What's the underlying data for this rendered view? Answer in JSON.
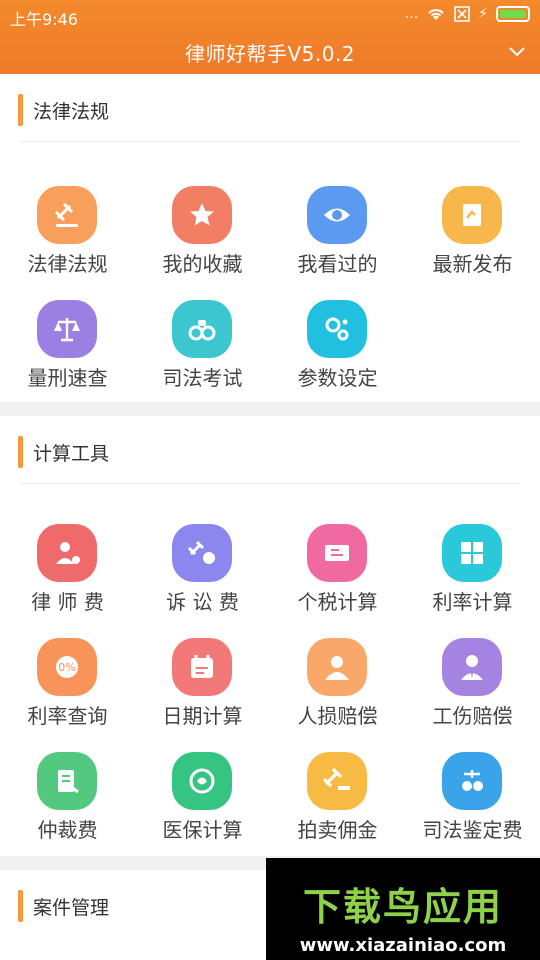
{
  "status_bar": {
    "time": "上午9:46",
    "dots": "...",
    "wifi": "wifi-icon",
    "sim": "sim-icon",
    "charge": "⚡"
  },
  "header": {
    "title": "律师好帮手V5.0.2"
  },
  "sections": {
    "laws": {
      "title": "法律法规",
      "items": [
        {
          "label": "法律法规",
          "icon": "gavel-icon",
          "color": "#f8a05b"
        },
        {
          "label": "我的收藏",
          "icon": "star-icon",
          "color": "#f27e63"
        },
        {
          "label": "我看过的",
          "icon": "eye-icon",
          "color": "#5b9af0"
        },
        {
          "label": "最新发布",
          "icon": "document-icon",
          "color": "#f7b74a"
        },
        {
          "label": "量刑速查",
          "icon": "scale-icon",
          "color": "#9b7fe3"
        },
        {
          "label": "司法考试",
          "icon": "handcuffs-icon",
          "color": "#3cc6cf"
        },
        {
          "label": "参数设定",
          "icon": "gears-icon",
          "color": "#21bfe0"
        }
      ]
    },
    "calc": {
      "title": "计算工具",
      "items": [
        {
          "label": "律 师 费",
          "icon": "lawyer-fee-icon",
          "color": "#ef6a6a"
        },
        {
          "label": "诉 讼 费",
          "icon": "litigation-fee-icon",
          "color": "#8c86ef"
        },
        {
          "label": "个税计算",
          "icon": "tax-icon",
          "color": "#f06aa0"
        },
        {
          "label": "利率计算",
          "icon": "calculator-icon",
          "color": "#29c9d9"
        },
        {
          "label": "利率查询",
          "icon": "percent-icon",
          "color": "#f8945a"
        },
        {
          "label": "日期计算",
          "icon": "calendar-icon",
          "color": "#f37878"
        },
        {
          "label": "人损赔偿",
          "icon": "person-icon",
          "color": "#f9a86a"
        },
        {
          "label": "工伤赔偿",
          "icon": "worker-icon",
          "color": "#a583e2"
        },
        {
          "label": "仲裁费",
          "icon": "form-icon",
          "color": "#52c97e"
        },
        {
          "label": "医保计算",
          "icon": "insurance-icon",
          "color": "#35c482"
        },
        {
          "label": "拍卖佣金",
          "icon": "auction-icon",
          "color": "#f7bb45"
        },
        {
          "label": "司法鉴定费",
          "icon": "appraisal-icon",
          "color": "#3aa4ea"
        }
      ]
    },
    "cases": {
      "title": "案件管理"
    }
  },
  "watermark": {
    "logo": "下载鸟应用",
    "url": "www.xiazainiao.com"
  }
}
